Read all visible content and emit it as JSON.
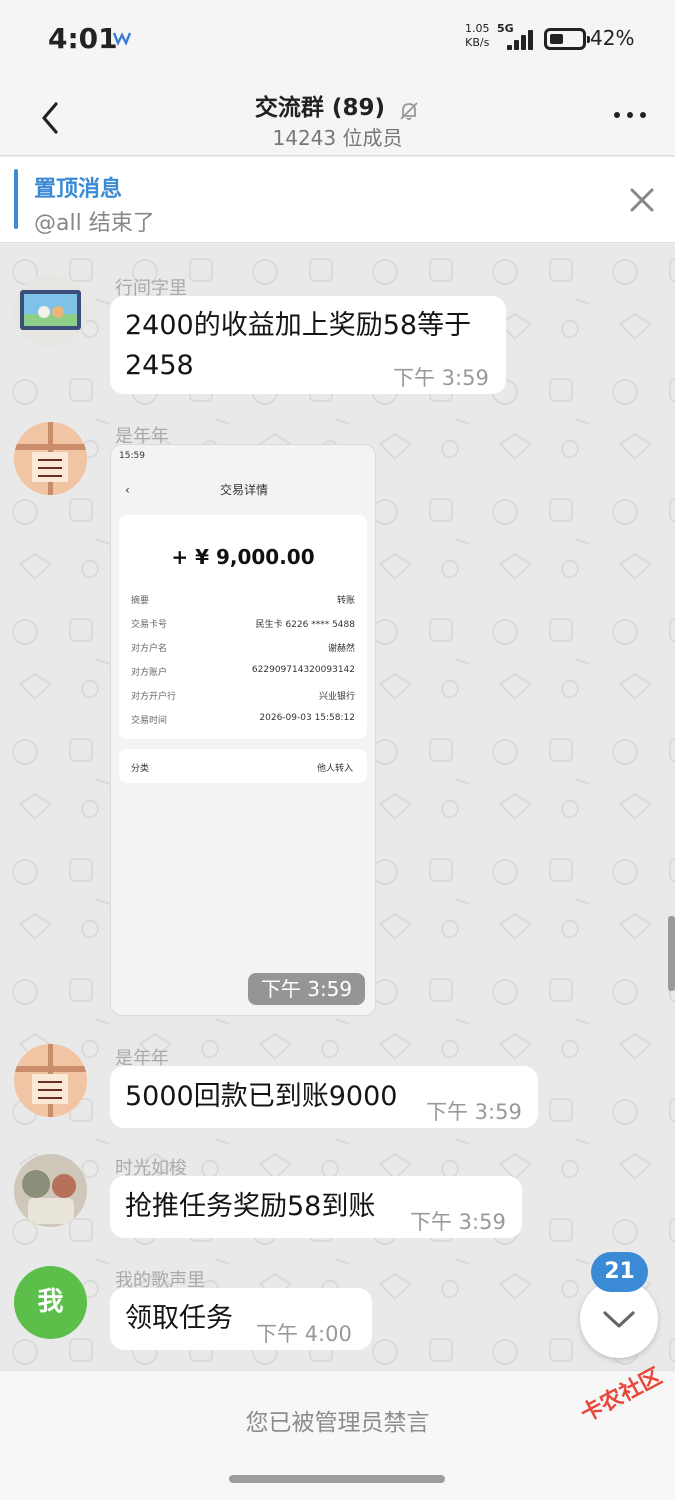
{
  "status_bar": {
    "time": "4:01",
    "speed_value": "1.05",
    "speed_unit": "KB/s",
    "network": "5G",
    "battery_percent": "42%",
    "battery_level": 0.42,
    "app_icon": "app-logo-icon"
  },
  "header": {
    "title": "交流群 (89)",
    "subtitle": "14243 位成员",
    "icons": [
      "back-arrow-icon",
      "muted-bell-icon",
      "more-dots-icon"
    ]
  },
  "pinned": {
    "title": "置顶消息",
    "text": "@all 结束了",
    "icon": "close-icon"
  },
  "messages": [
    {
      "sender": "行间字里",
      "text_line1": "2400的收益加上奖励58等于",
      "text_line2": "2458",
      "time": "下午  3:59"
    },
    {
      "sender": "是年年",
      "time": "下午  3:59",
      "image": {
        "status_time": "15:59",
        "nav_title": "交易详情",
        "amount": "+ ¥ 9,000.00",
        "rows": [
          {
            "label": "摘要",
            "value": "转账"
          },
          {
            "label": "交易卡号",
            "value": "民生卡 6226 **** 5488"
          },
          {
            "label": "对方户名",
            "value": "谢赫然"
          },
          {
            "label": "对方账户",
            "value": "622909714320093142"
          },
          {
            "label": "对方开户行",
            "value": "兴业银行"
          },
          {
            "label": "交易时间",
            "value": "2026-09-03 15:58:12"
          }
        ],
        "category_label": "分类",
        "category_value": "他人转入"
      }
    },
    {
      "sender": "是年年",
      "text": "5000回款已到账9000",
      "time": "下午  3:59"
    },
    {
      "sender": "时光如梭",
      "text": "抢推任务奖励58到账",
      "time": "下午  3:59"
    },
    {
      "sender": "我的歌声里",
      "avatar_text": "我",
      "text": "领取任务",
      "time": "下午  4:00"
    }
  ],
  "unread_badge": "21",
  "bottom": {
    "banned_text": "您已被管理员禁言"
  },
  "watermark": "卡农社区",
  "colors": {
    "accent": "#3a8ad6",
    "avatar_green": "#5cbf49",
    "watermark": "#e8473a"
  }
}
